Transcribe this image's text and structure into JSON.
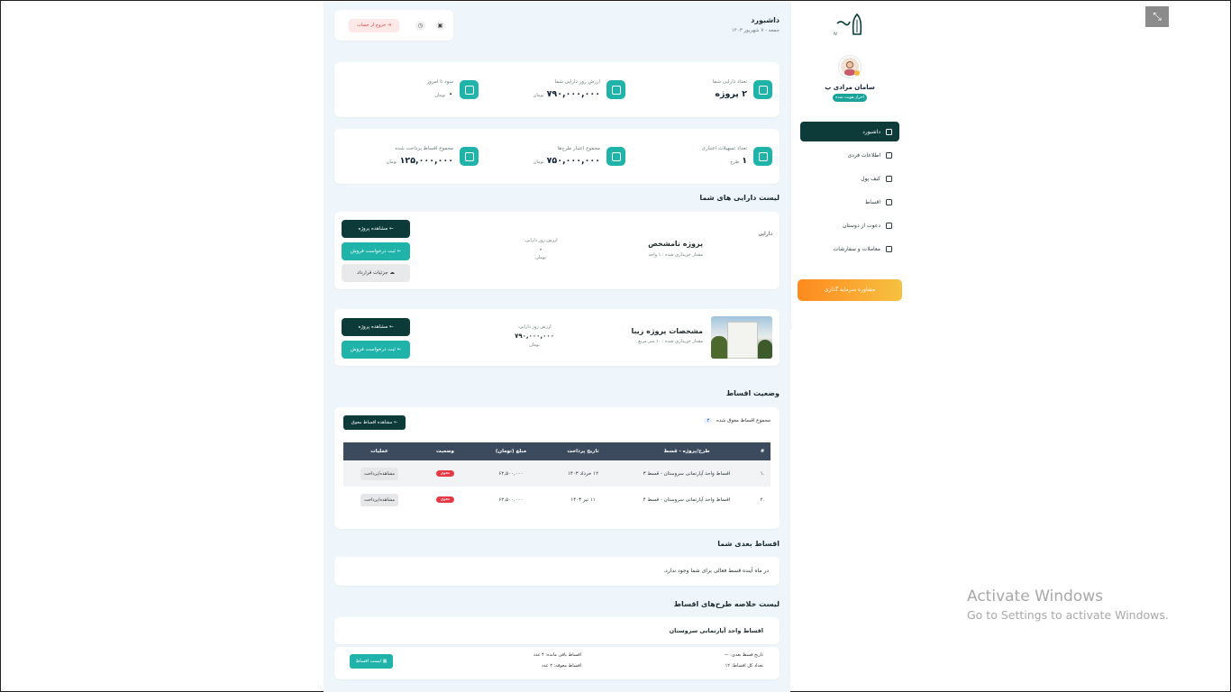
{
  "sidebar": {
    "user_name": "سامان مرادی پ",
    "user_badge": "احراز هویت شده",
    "items": [
      {
        "label": "داشبورد",
        "active": true
      },
      {
        "label": "اطلاعات فردی"
      },
      {
        "label": "کیف پول"
      },
      {
        "label": "اقساط"
      },
      {
        "label": "دعوت از دوستان"
      },
      {
        "label": "معاملات و سفارشات"
      }
    ],
    "consult_label": "مشاوره سرمایه گذاری"
  },
  "header": {
    "title": "داشبورد",
    "date": "جمعه - ۷ شهریور ۱۴۰۳",
    "logout_label": "خروج از حساب"
  },
  "stats_row1": [
    {
      "label": "تعداد دارایی شما",
      "value": "۲ پروژه",
      "unit": ""
    },
    {
      "label": "ارزش روز دارایی شما",
      "value": "۷۹۰,۰۰۰,۰۰۰",
      "unit": "تومان"
    },
    {
      "label": "سود تا امروز",
      "value": "۰",
      "unit": "تومان"
    }
  ],
  "stats_row2": [
    {
      "label": "تعداد تسهیلات اعتباری",
      "value": "۱",
      "unit": "طرح"
    },
    {
      "label": "مجموع اعتبار طرح‌ها",
      "value": "۷۵۰,۰۰۰,۰۰۰",
      "unit": "تومان"
    },
    {
      "label": "مجموع اقساط پرداخت شده",
      "value": "۱۲۵,۰۰۰,۰۰۰",
      "unit": "تومان"
    }
  ],
  "assets_title": "لیست دارایی های شما",
  "assets": [
    {
      "tag": "دارایی",
      "name": "پروژه نامشخص",
      "amount": "مقدار خریداری شده : ۱ واحد",
      "value_label": "ارزش روز دارایی:",
      "value": "۰",
      "unit": "تومان",
      "buttons": [
        "مشاهده پروژه",
        "ثبت درخواست فروش",
        "جزئیات قرارداد"
      ]
    },
    {
      "name": "مشخصات پروژه زیبا",
      "amount": "مقدار خریداری شده : ۱۰ متر مربع",
      "value_label": "ارزش روز دارایی:",
      "value": "۷۹۰,۰۰۰,۰۰۰",
      "unit": "تومان",
      "buttons": [
        "مشاهده پروژه",
        "ثبت درخواست فروش"
      ]
    }
  ],
  "installments": {
    "title": "وضعیت اقساط",
    "overdue_label": "مجموع اقساط معوق شده",
    "overdue_count": "۲",
    "overdue_button": "مشاهده اقساط معوق",
    "columns": [
      "#",
      "طرح/پروژه - قسط",
      "تاریخ پرداخت",
      "مبلغ (تومان)",
      "وضعیت",
      "عملیات"
    ],
    "rows": [
      {
        "num": ".۱",
        "plan": "اقساط واحد آپارتمانی سروستان - قسط ۳",
        "date": "۱۲ خرداد ۱۴۰۳",
        "amount": "۶۲,۵۰۰,۰۰۰",
        "status": "معوق",
        "action": "مشاهده/پرداخت"
      },
      {
        "num": ".۲",
        "plan": "اقساط واحد آپارتمانی سروستان - قسط ۴",
        "date": "۱۱ تیر ۱۴۰۳",
        "amount": "۶۲,۵۰۰,۰۰۰",
        "status": "معوق",
        "action": "مشاهده/پرداخت"
      }
    ]
  },
  "next_installments": {
    "title": "اقساط بعدی شما",
    "empty": "در ماه آینده قسط فعالی برای شما وجود ندارد."
  },
  "plans": {
    "title": "لیست خلاصه طرح‌های اقساط",
    "plan_name": "اقساط واحد آپارتمانی سروستان",
    "next_date": "تاریخ قسط بعدی: —",
    "total_count": "تعداد کل اقساط: ۱۲",
    "remaining": "اقساط باقی مانده: ۴ عدد",
    "overdue": "اقساط معوقه: ۲ عدد",
    "button": "لیست اقساط"
  },
  "watermark": {
    "line1": "Activate Windows",
    "line2": "Go to Settings to activate Windows."
  },
  "colors": {
    "dark": "#0c3b3a",
    "teal": "#1fb3aa",
    "danger": "#e53945",
    "accent": "#ff8a1e"
  }
}
